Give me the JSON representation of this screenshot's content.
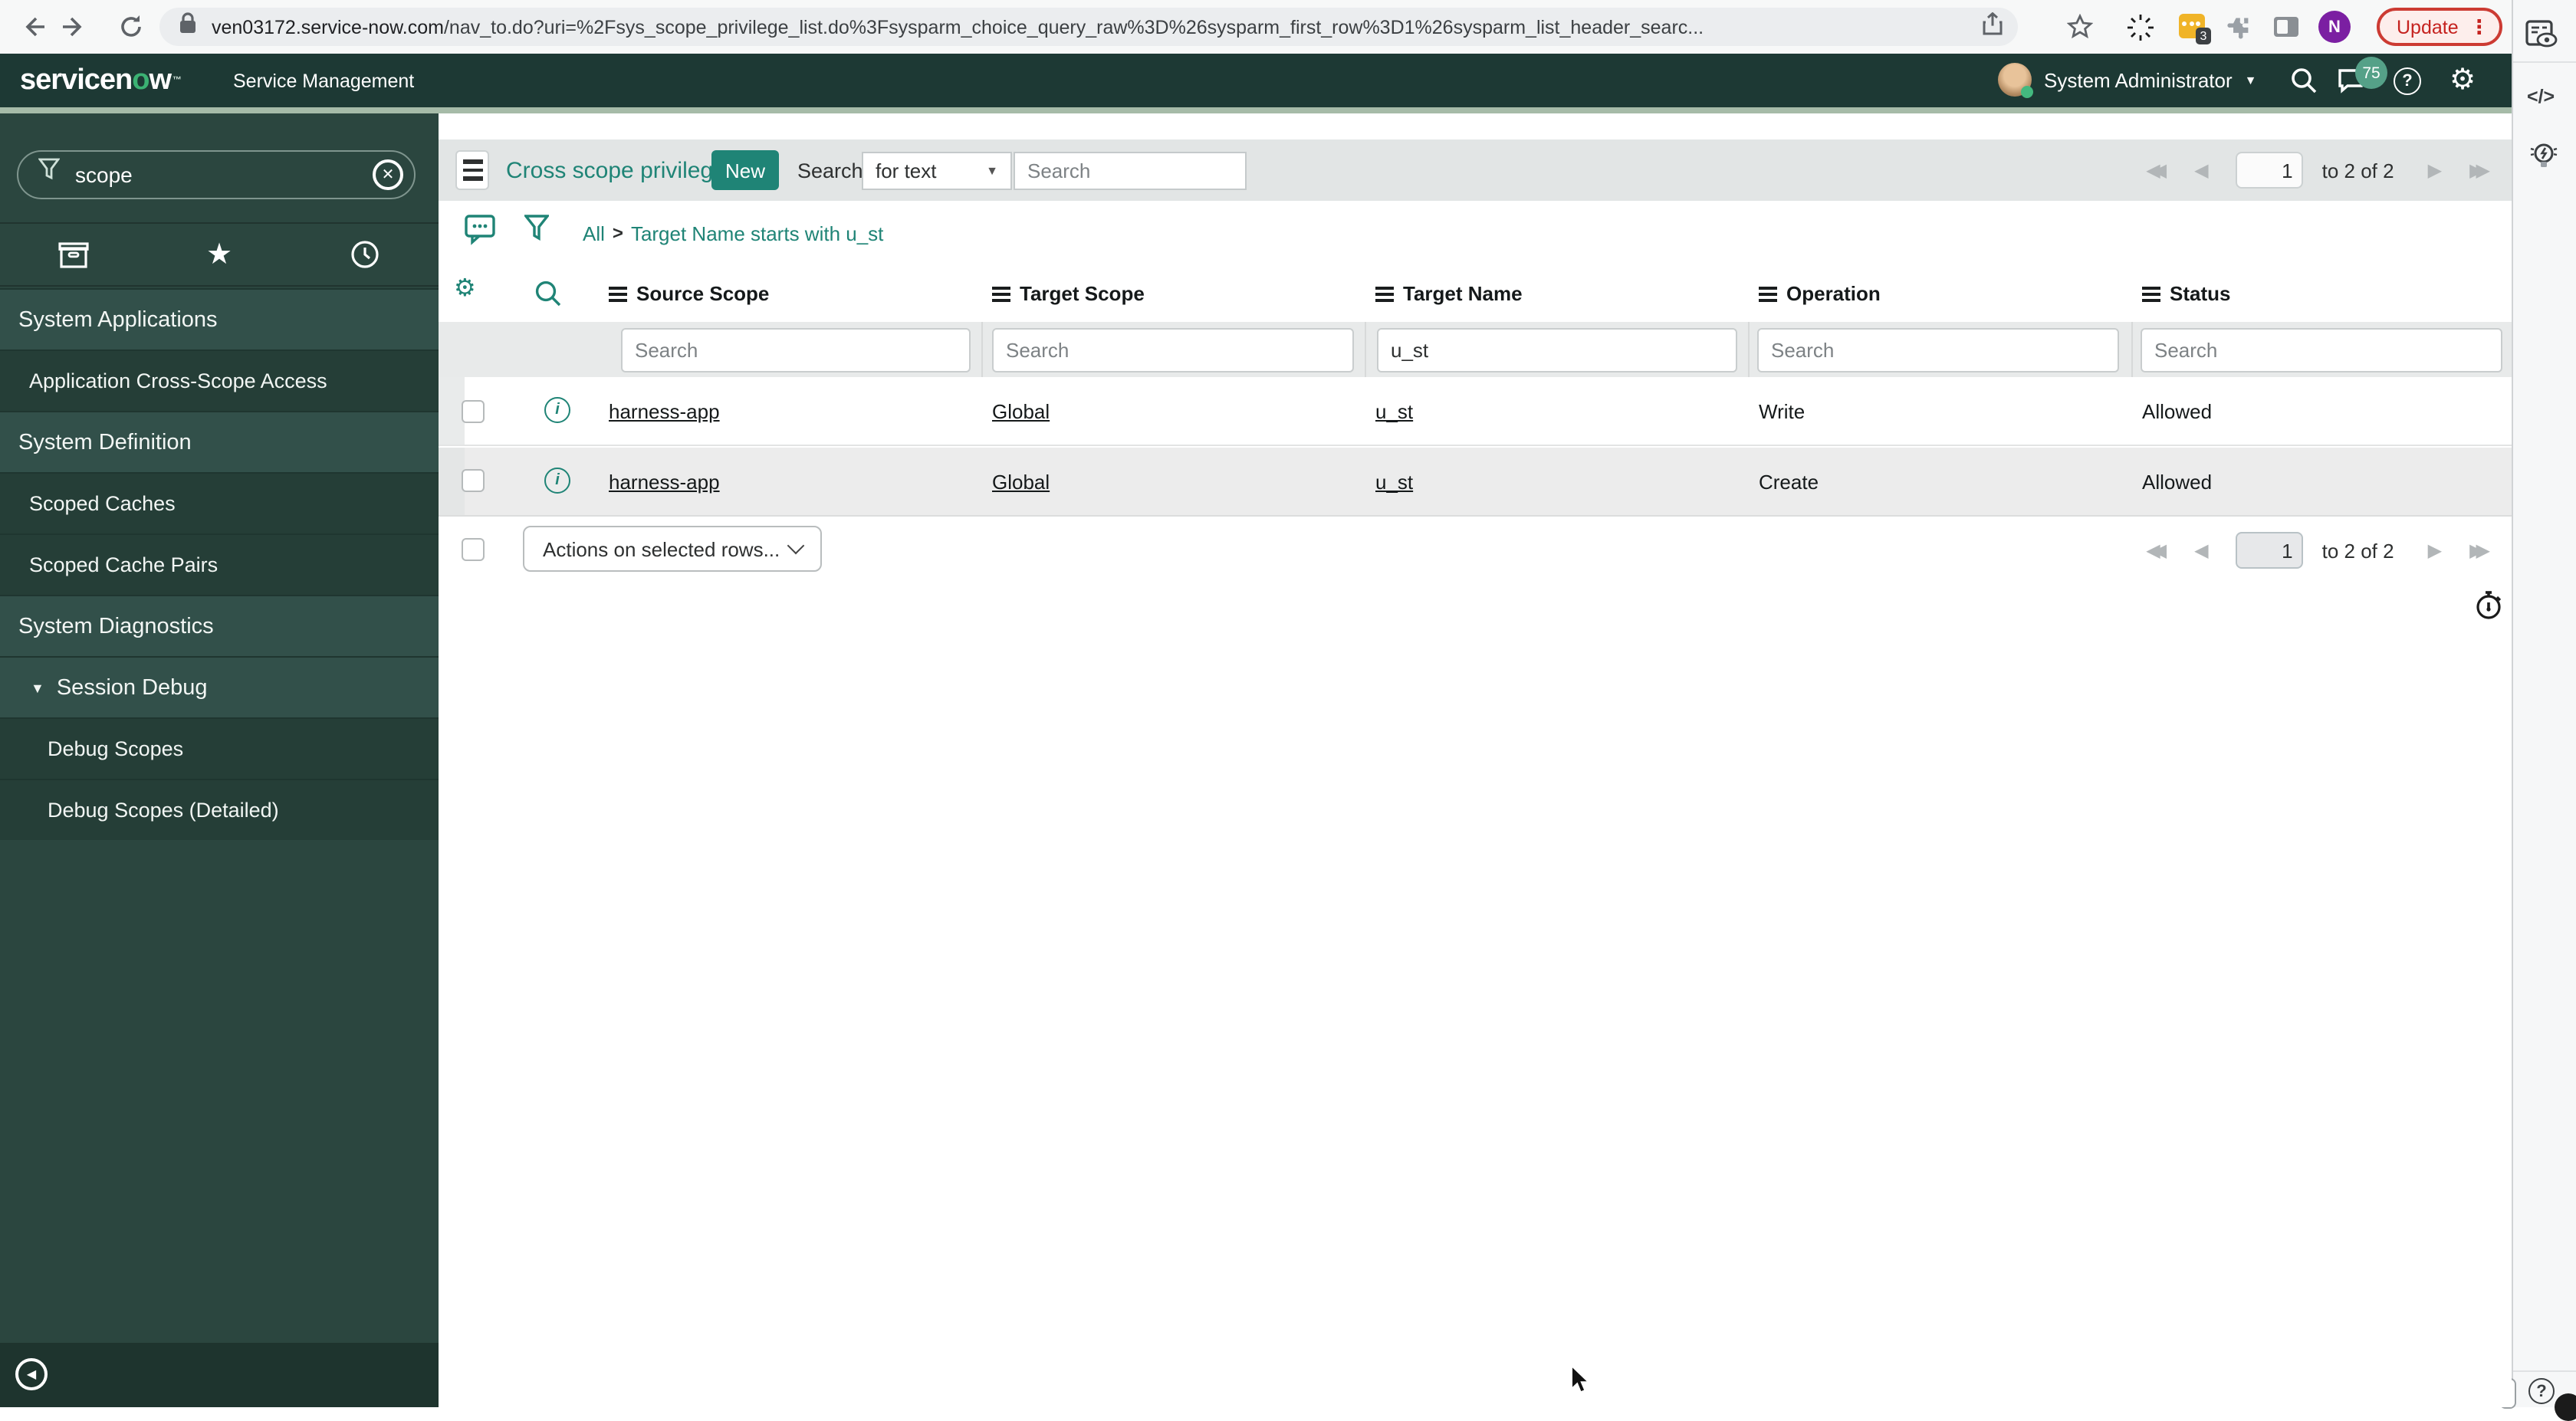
{
  "browser": {
    "url_domain": "ven03172.service-now.com",
    "url_rest": "/nav_to.do?uri=%2Fsys_scope_privilege_list.do%3Fsysparm_choice_query_raw%3D%26sysparm_first_row%3D1%26sysparm_list_header_searc...",
    "extension_badge": "3",
    "profile_initial": "N",
    "update_label": "Update"
  },
  "header": {
    "logo_prefix": "servicen",
    "logo_o": "o",
    "logo_suffix": "w",
    "logo_tm": "™",
    "product": "Service Management",
    "user": "System Administrator",
    "notification_count": "75"
  },
  "sidebar": {
    "search_value": "scope",
    "items": [
      {
        "type": "section",
        "label": "System Applications"
      },
      {
        "type": "item",
        "label": "Application Cross-Scope Access"
      },
      {
        "type": "section",
        "label": "System Definition"
      },
      {
        "type": "item",
        "label": "Scoped Caches"
      },
      {
        "type": "item",
        "label": "Scoped Cache Pairs"
      },
      {
        "type": "section",
        "label": "System Diagnostics"
      },
      {
        "type": "subsection",
        "label": "Session Debug"
      },
      {
        "type": "subitem",
        "label": "Debug Scopes"
      },
      {
        "type": "subitem",
        "label": "Debug Scopes (Detailed)"
      }
    ]
  },
  "toolbar": {
    "title": "Cross scope privileges",
    "new_label": "New",
    "search_label": "Search",
    "search_type": "for text",
    "search_placeholder": "Search"
  },
  "breadcrumb": {
    "all": "All",
    "sep": ">",
    "query": "Target Name starts with u_st"
  },
  "table": {
    "columns": [
      "Source Scope",
      "Target Scope",
      "Target Name",
      "Operation",
      "Status"
    ],
    "filter_placeholder": "Search",
    "target_name_filter": "u_st",
    "rows": [
      {
        "source_scope": "harness-app",
        "target_scope": "Global",
        "target_name": "u_st",
        "operation": "Write",
        "status": "Allowed"
      },
      {
        "source_scope": "harness-app",
        "target_scope": "Global",
        "target_name": "u_st",
        "operation": "Create",
        "status": "Allowed"
      }
    ],
    "actions_label": "Actions on selected rows..."
  },
  "pagination": {
    "page": "1",
    "range": "to 2 of 2"
  },
  "icons": {
    "first": "◀◀",
    "prev": "◀",
    "next": "▶",
    "last": "▶▶",
    "caret_down": "▼",
    "gear": "⚙",
    "star": "★",
    "code": "</>",
    "kebab": "⋮",
    "question": "?",
    "close": "✕",
    "back_triangle": "◀"
  }
}
